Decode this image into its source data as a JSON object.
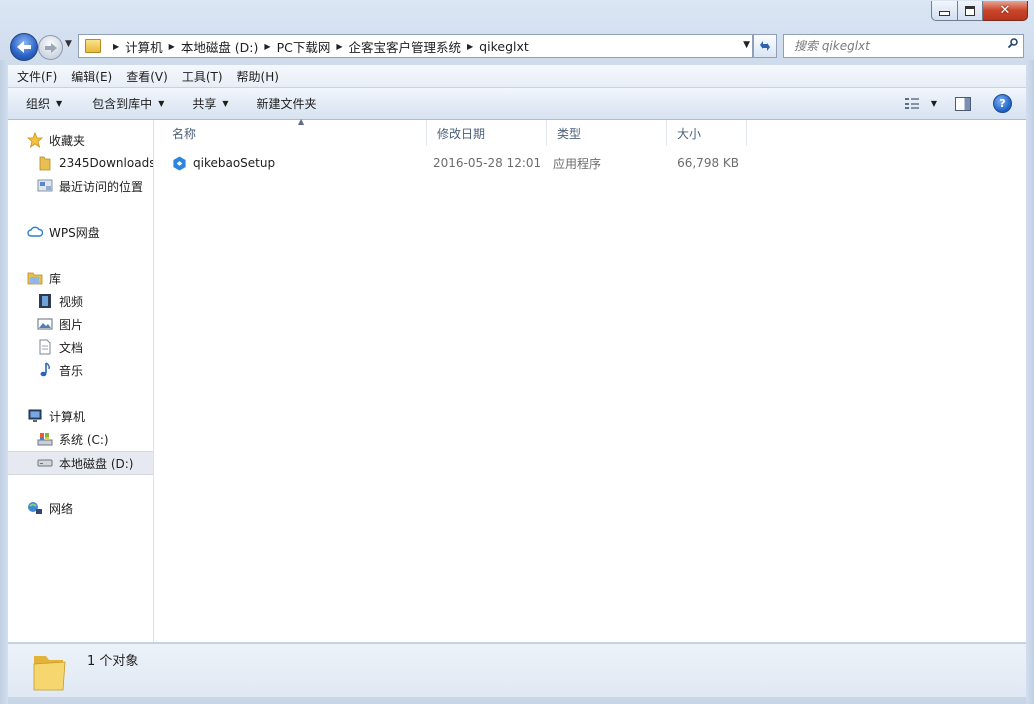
{
  "window": {
    "minimize_glyph": "—",
    "maximize_glyph": "□",
    "close_glyph": "✕"
  },
  "address": {
    "crumbs": [
      "计算机",
      "本地磁盘 (D:)",
      "PC下载网",
      "企客宝客户管理系统",
      "qikeglxt"
    ]
  },
  "search": {
    "placeholder": "搜索 qikeglxt"
  },
  "menu": [
    "文件(F)",
    "编辑(E)",
    "查看(V)",
    "工具(T)",
    "帮助(H)"
  ],
  "toolbar": {
    "organize": "组织",
    "include_in_library": "包含到库中",
    "share": "共享",
    "new_folder": "新建文件夹",
    "help_glyph": "?"
  },
  "nav": {
    "favorites": "收藏夹",
    "fav_items": [
      "2345Downloads",
      "最近访问的位置"
    ],
    "wps": "WPS网盘",
    "libraries": "库",
    "lib_items": [
      "视频",
      "图片",
      "文档",
      "音乐"
    ],
    "computer": "计算机",
    "drives": [
      "系统 (C:)",
      "本地磁盘 (D:)"
    ],
    "network": "网络"
  },
  "columns": {
    "name": "名称",
    "modified": "修改日期",
    "type": "类型",
    "size": "大小"
  },
  "files": [
    {
      "name": "qikebaoSetup",
      "modified": "2016-05-28 12:01",
      "type": "应用程序",
      "size": "66,798 KB"
    }
  ],
  "status": {
    "count": "1 个对象"
  },
  "colors": {
    "accent": "#2a62c7",
    "folder": "#e6b93c",
    "close_button": "#c9452a"
  }
}
